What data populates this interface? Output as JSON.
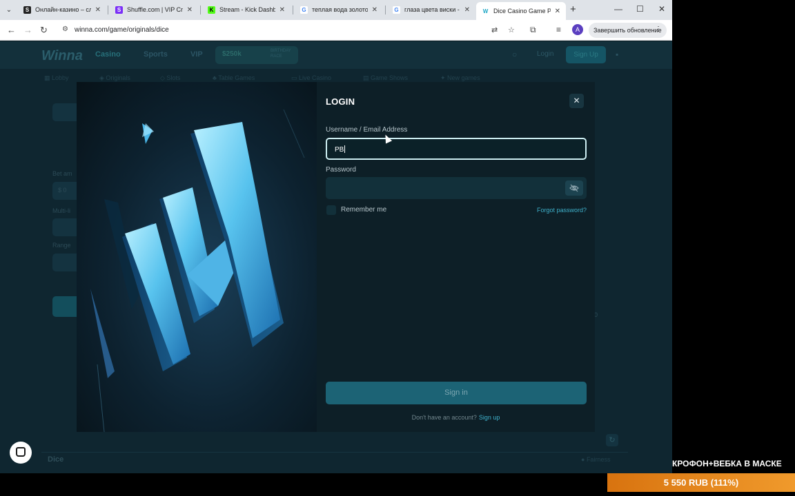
{
  "browser": {
    "tabs": [
      {
        "title": "Онлайн-казино – слот",
        "favicon": "page-icon",
        "color": "#222222"
      },
      {
        "title": "Shuffle.com | VIP Crypt",
        "favicon": "shuffle-icon",
        "color": "#7b2ff7"
      },
      {
        "title": "Stream - Kick Dashboa",
        "favicon": "kick-icon",
        "color": "#53fc18"
      },
      {
        "title": "теплая вода золотой",
        "favicon": "google-icon",
        "color": "#4285f4"
      },
      {
        "title": "глаза цвета виски - Go",
        "favicon": "google-icon",
        "color": "#4285f4"
      },
      {
        "title": "Dice Casino Game Play",
        "favicon": "winna-icon",
        "color": "#1ea7c5",
        "active": true
      }
    ],
    "url": "winna.com/game/originals/dice",
    "profile_initial": "A",
    "update_label": "Завершить обновление"
  },
  "site": {
    "logo": "Winna",
    "nav": [
      "Casino",
      "Sports",
      "VIP"
    ],
    "promo": {
      "amount": "$250k",
      "line1": "BIRTHDAY",
      "line2": "RACE"
    },
    "login_label": "Login",
    "signup_label": "Sign Up",
    "subnav": [
      "Lobby",
      "Originals",
      "Slots",
      "Table Games",
      "Live Casino",
      "Game Shows",
      "New games"
    ],
    "side": {
      "bet_amount": "Bet am",
      "bet_value": "$ 0",
      "multi": "Multi-li",
      "range": "Range"
    },
    "right_number": "0",
    "footer_title": "Dice",
    "footer_fairness": "Fairness"
  },
  "modal": {
    "title": "LOGIN",
    "username_label": "Username / Email Address",
    "username_value": "PB",
    "password_label": "Password",
    "remember_label": "Remember me",
    "forgot_label": "Forgot password?",
    "signin_label": "Sign in",
    "no_account_text": "Don't have an account?",
    "signup_link": "Sign up"
  },
  "overlay": {
    "caption": "КРОФОН+ВЕБКА В МАСКЕ",
    "donation": "5 550 RUB (111%)"
  }
}
